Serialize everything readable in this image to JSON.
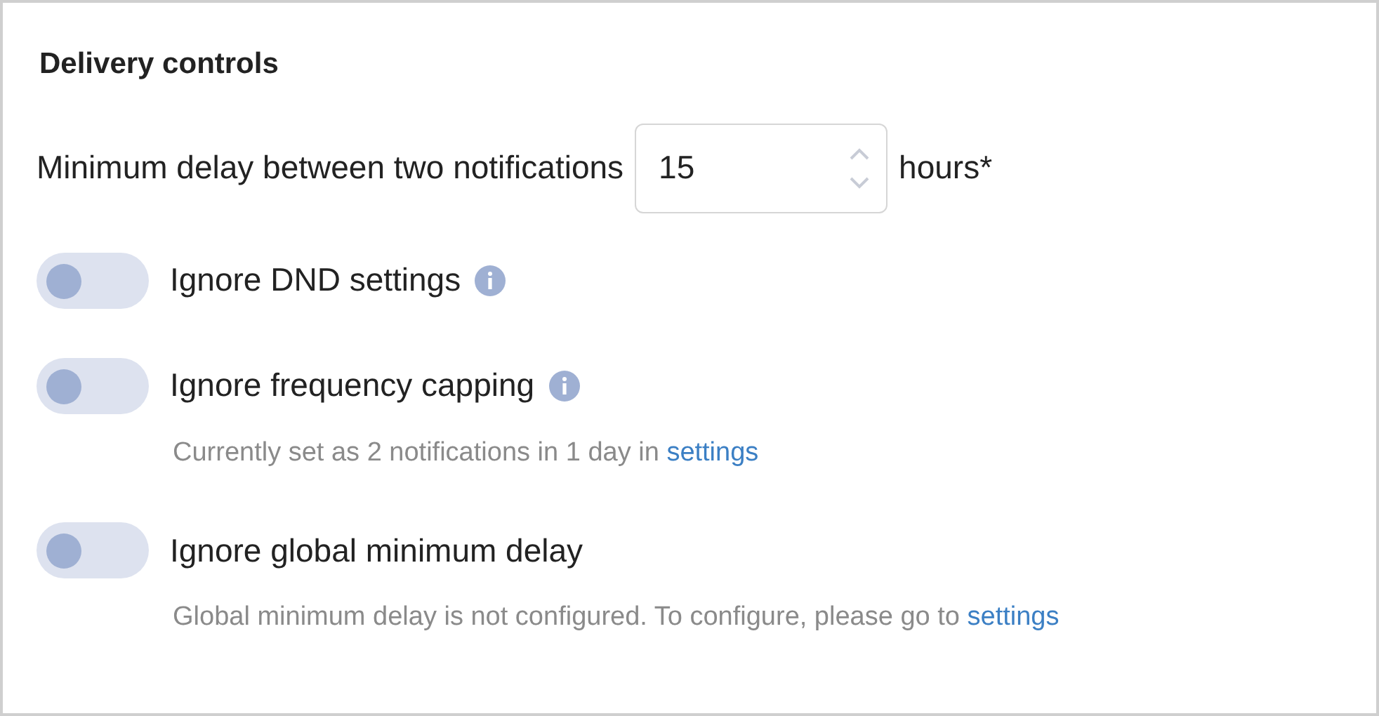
{
  "title": "Delivery controls",
  "delay": {
    "label": "Minimum delay between two notifications",
    "value": "15",
    "unit": "hours*"
  },
  "toggles": [
    {
      "label": "Ignore DND settings",
      "on": false,
      "info": true
    },
    {
      "label": "Ignore frequency capping",
      "on": false,
      "info": true,
      "note": {
        "text": "Currently set as 2 notifications in 1 day in",
        "link": "settings"
      }
    },
    {
      "label": "Ignore global minimum delay",
      "on": false,
      "info": false,
      "note": {
        "text": "Global minimum delay is not configured. To configure, please go to",
        "link": "settings"
      }
    }
  ]
}
